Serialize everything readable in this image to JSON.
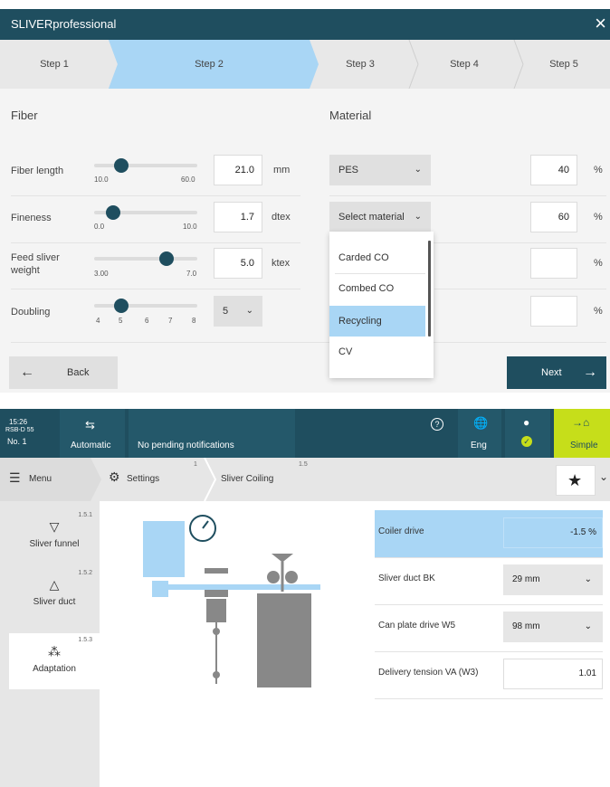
{
  "wizard": {
    "title": "SLIVERprofessional",
    "close_icon": "×",
    "steps": [
      "Step 1",
      "Step 2",
      "Step 3",
      "Step 4",
      "Step 5"
    ],
    "active_step": 2,
    "fiber_heading": "Fiber",
    "material_heading": "Material",
    "rows": {
      "fiber_length": {
        "label": "Fiber length",
        "min": "10.0",
        "max": "60.0",
        "value": "21.0",
        "unit": "mm",
        "level": 0.22
      },
      "fineness": {
        "label": "Fineness",
        "min": "0.0",
        "max": "10.0",
        "value": "1.7",
        "unit": "dtex",
        "level": 0.17
      },
      "feed_sliver_weight": {
        "label": "Feed sliver weight",
        "min": "3.00",
        "max": "7.0",
        "value": "5.0",
        "unit": "ktex",
        "level": 0.7
      },
      "doubling": {
        "label": "Doubling",
        "ticks": [
          "4",
          "5",
          "6",
          "7",
          "8"
        ],
        "value": "5",
        "level": 0.25
      }
    },
    "materials": [
      {
        "select": "PES",
        "percent": "40",
        "unit": "%"
      },
      {
        "select": "Select material",
        "percent": "60",
        "unit": "%"
      },
      {
        "percent": "",
        "unit": "%"
      },
      {
        "percent": "",
        "unit": "%"
      }
    ],
    "dropdown_options": [
      "Carded CO",
      "Combed CO",
      "Recycling",
      "CV"
    ],
    "dropdown_highlight": "Recycling",
    "back_label": "Back",
    "next_label": "Next"
  },
  "machine": {
    "time": "15:26",
    "machine_id": "RSB-D 55",
    "machine_no": "No. 1",
    "mode_label": "Automatic",
    "notification": "No pending notifications",
    "language": "Eng",
    "level_label": "Simple",
    "breadcrumb": {
      "menu": "Menu",
      "settings": "Settings",
      "settings_num": "1",
      "current": "Sliver Coiling",
      "current_num": "1.5"
    },
    "nav": [
      {
        "num": "1.5.1",
        "label": "Sliver funnel",
        "icon": "funnel-icon"
      },
      {
        "num": "1.5.2",
        "label": "Sliver duct",
        "icon": "duct-icon"
      },
      {
        "num": "1.5.3",
        "label": "Adaptation",
        "icon": "adaptation-icon"
      }
    ],
    "params": [
      {
        "label": "Coiler drive",
        "value": "-1.5 %",
        "kind": "readonly"
      },
      {
        "label": "Sliver duct BK",
        "value": "29 mm",
        "kind": "select"
      },
      {
        "label": "Can plate drive W5",
        "value": "98 mm",
        "kind": "select"
      },
      {
        "label": "Delivery tension VA (W3)",
        "value": "1.01",
        "kind": "input"
      }
    ],
    "colors": {
      "dark_teal": "#1f4e5f",
      "highlight_blue": "#a9d6f5",
      "lime": "#c6de1a"
    }
  }
}
